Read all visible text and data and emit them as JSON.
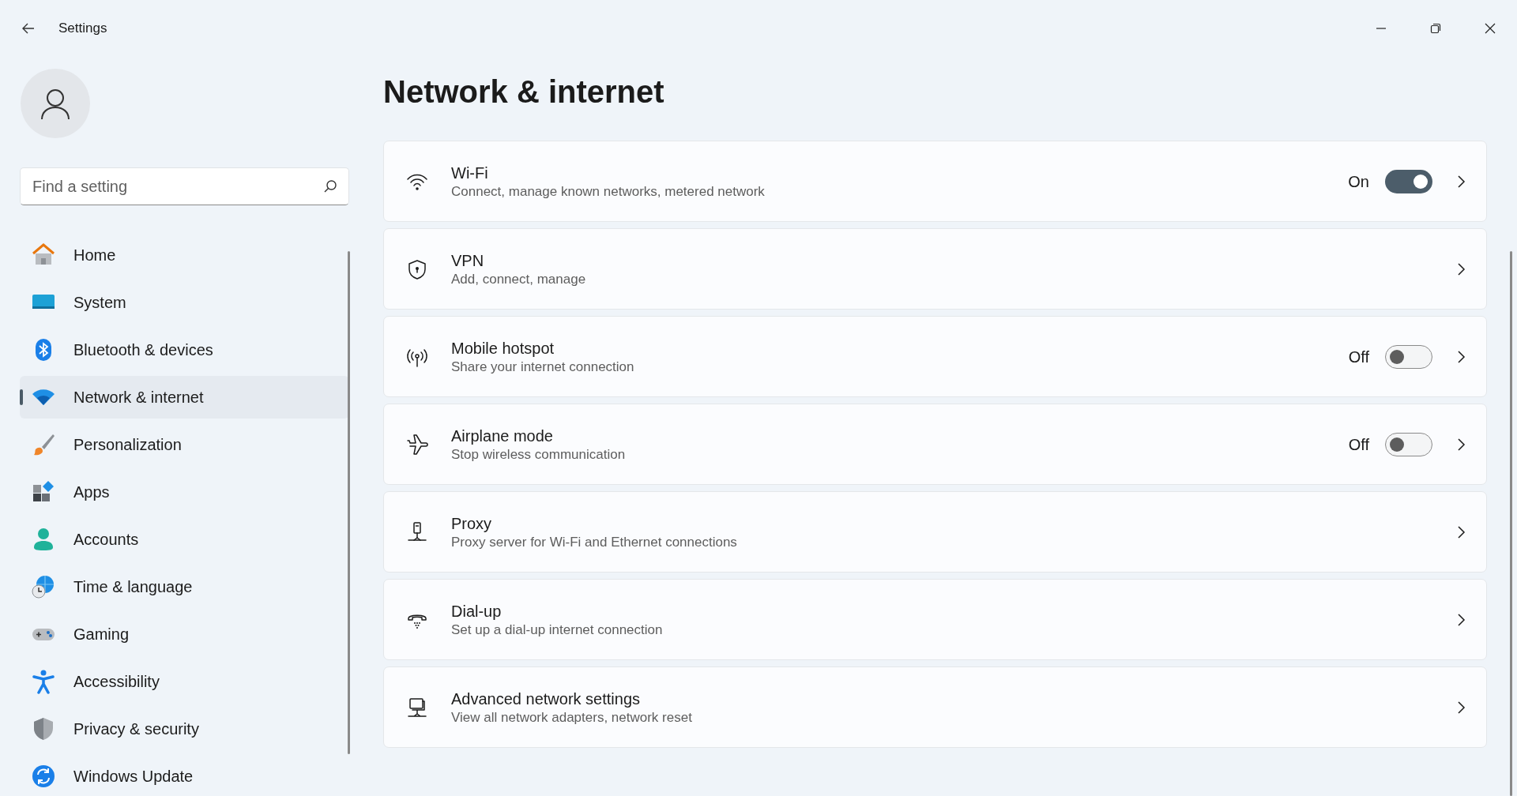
{
  "window": {
    "title": "Settings"
  },
  "search": {
    "placeholder": "Find a setting"
  },
  "sidebar": {
    "items": [
      {
        "label": "Home",
        "selected": false
      },
      {
        "label": "System",
        "selected": false
      },
      {
        "label": "Bluetooth & devices",
        "selected": false
      },
      {
        "label": "Network & internet",
        "selected": true
      },
      {
        "label": "Personalization",
        "selected": false
      },
      {
        "label": "Apps",
        "selected": false
      },
      {
        "label": "Accounts",
        "selected": false
      },
      {
        "label": "Time & language",
        "selected": false
      },
      {
        "label": "Gaming",
        "selected": false
      },
      {
        "label": "Accessibility",
        "selected": false
      },
      {
        "label": "Privacy & security",
        "selected": false
      },
      {
        "label": "Windows Update",
        "selected": false
      }
    ]
  },
  "page": {
    "title": "Network & internet",
    "cards": [
      {
        "kind": "toggle",
        "title": "Wi-Fi",
        "subtitle": "Connect, manage known networks, metered network",
        "state_label": "On",
        "on": true
      },
      {
        "kind": "link",
        "title": "VPN",
        "subtitle": "Add, connect, manage"
      },
      {
        "kind": "toggle",
        "title": "Mobile hotspot",
        "subtitle": "Share your internet connection",
        "state_label": "Off",
        "on": false
      },
      {
        "kind": "toggle",
        "title": "Airplane mode",
        "subtitle": "Stop wireless communication",
        "state_label": "Off",
        "on": false
      },
      {
        "kind": "link",
        "title": "Proxy",
        "subtitle": "Proxy server for Wi-Fi and Ethernet connections"
      },
      {
        "kind": "link",
        "title": "Dial-up",
        "subtitle": "Set up a dial-up internet connection"
      },
      {
        "kind": "link",
        "title": "Advanced network settings",
        "subtitle": "View all network adapters, network reset"
      }
    ]
  }
}
